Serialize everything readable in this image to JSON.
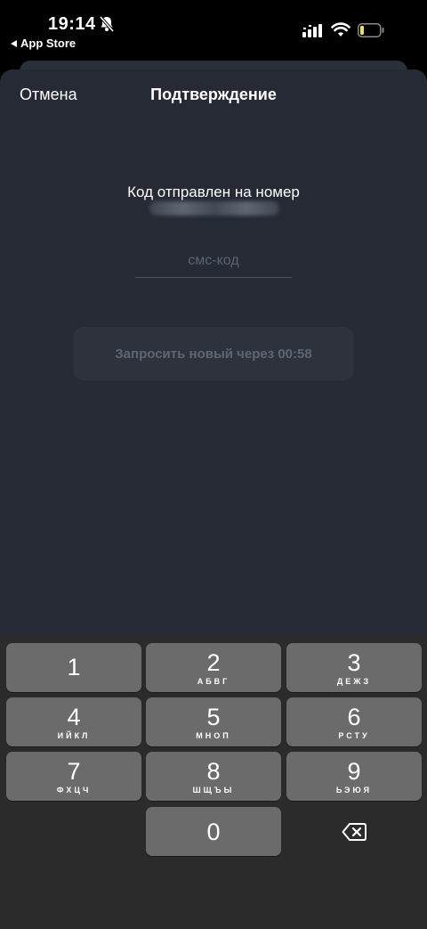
{
  "status_bar": {
    "time": "19:14",
    "back_app": "App Store"
  },
  "nav": {
    "cancel_label": "Отмена",
    "title": "Подтверждение"
  },
  "content": {
    "sent_label": "Код отправлен на номер",
    "code_placeholder": "смс-код",
    "resend_label": "Запросить новый через 00:58"
  },
  "keypad": {
    "keys": [
      {
        "digit": "1",
        "letters": ""
      },
      {
        "digit": "2",
        "letters": "АБВГ"
      },
      {
        "digit": "3",
        "letters": "ДЕЖЗ"
      },
      {
        "digit": "4",
        "letters": "ИЙКЛ"
      },
      {
        "digit": "5",
        "letters": "МНОП"
      },
      {
        "digit": "6",
        "letters": "РСТУ"
      },
      {
        "digit": "7",
        "letters": "ФХЦЧ"
      },
      {
        "digit": "8",
        "letters": "ШЩЪЫ"
      },
      {
        "digit": "9",
        "letters": "ЬЭЮЯ"
      },
      {
        "digit": "0",
        "letters": ""
      }
    ]
  },
  "colors": {
    "sheet_bg": "#252a35",
    "keypad_bg": "#2b2b2b",
    "key_bg": "#6b6b6b",
    "battery_low": "#f4e04d"
  },
  "icons": {
    "bell": "bell-slash-icon",
    "signal": "cellular-signal-icon",
    "wifi": "wifi-icon",
    "battery": "battery-low-icon",
    "backspace": "delete-left-icon"
  }
}
